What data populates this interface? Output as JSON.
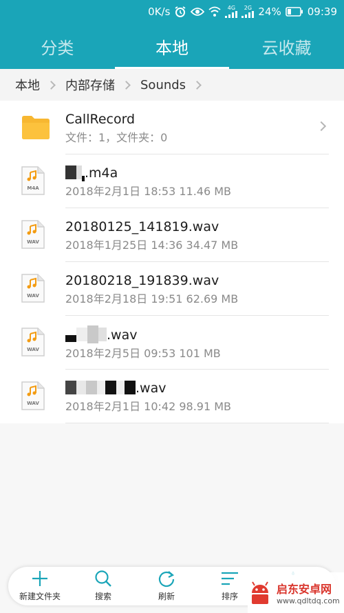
{
  "status_bar": {
    "speed": "0K/s",
    "network1": "4G",
    "network2": "2G",
    "battery": "24%",
    "time": "09:39"
  },
  "tabs": [
    {
      "label": "分类",
      "active": false
    },
    {
      "label": "本地",
      "active": true
    },
    {
      "label": "云收藏",
      "active": false
    }
  ],
  "breadcrumb": [
    "本地",
    "内部存储",
    "Sounds"
  ],
  "files": [
    {
      "kind": "folder",
      "name": "CallRecord",
      "meta": "文件：1，文件夹：0"
    },
    {
      "kind": "m4a",
      "badge": "M4A",
      "name": ".m4a",
      "meta": "2018年2月1日 18:53 11.46 MB"
    },
    {
      "kind": "wav",
      "badge": "WAV",
      "name": "20180125_141819.wav",
      "meta": "2018年1月25日 14:36 34.47 MB"
    },
    {
      "kind": "wav",
      "badge": "WAV",
      "name": "20180218_191839.wav",
      "meta": "2018年2月18日 19:51 62.69 MB"
    },
    {
      "kind": "wav",
      "badge": "WAV",
      "name": ".wav",
      "meta": "2018年2月5日 09:53 101 MB"
    },
    {
      "kind": "wav",
      "badge": "WAV",
      "name": ".wav",
      "meta": "2018年2月1日 10:42 98.91 MB"
    }
  ],
  "toolbar": {
    "new_folder": "新建文件夹",
    "search": "搜索",
    "refresh": "刷新",
    "sort": "排序"
  },
  "watermark": {
    "name": "启东安卓网",
    "url": "www.qdltdq.com"
  },
  "colors": {
    "header": "#1aa5b8",
    "accent": "#1aa5b8",
    "folder": "#f7b731",
    "music_note": "#f39c12"
  }
}
